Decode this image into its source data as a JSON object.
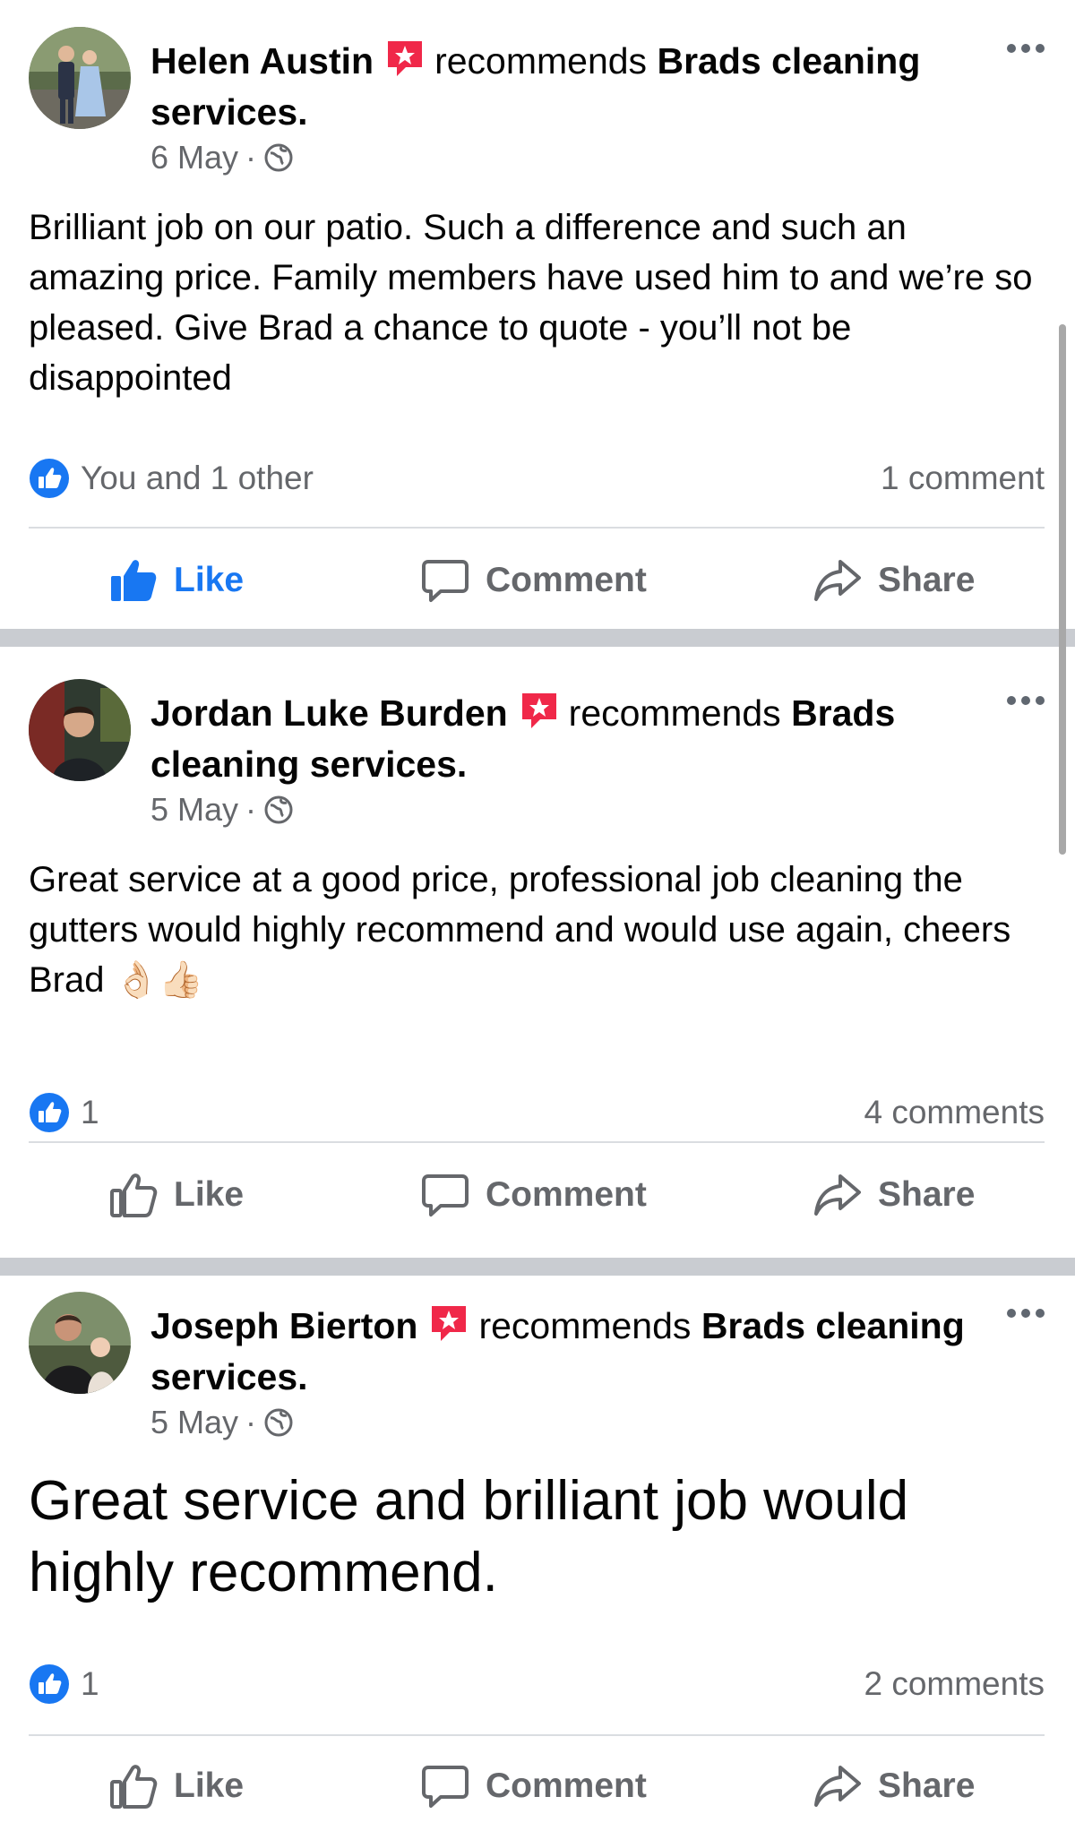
{
  "feed": {
    "recommends_word": "recommends",
    "more_icon": "more-horizontal-icon",
    "badge_icon": "recommendation-badge-icon",
    "audience_icon": "globe-icon",
    "meta_separator": "·",
    "actions": {
      "like": "Like",
      "comment": "Comment",
      "share": "Share"
    },
    "colors": {
      "accent": "#1877f2",
      "badge": "#f02849",
      "secondary_text": "#65676b",
      "separator": "#c9ccd1"
    }
  },
  "posts": [
    {
      "author": "Helen Austin",
      "page": "Brads cleaning services.",
      "date": "6 May",
      "text": "Brilliant job on our patio. Such a difference and such an amazing price. Family members have used him to and we’re so pleased. Give Brad a chance to quote - you’ll not be disappointed",
      "reactions": "You and 1 other",
      "comments": "1 comment",
      "liked_by_viewer": true
    },
    {
      "author": "Jordan Luke Burden",
      "page": "Brads cleaning services.",
      "date": "5 May",
      "text": "Great service at a good price, professional job cleaning the gutters would highly recommend and would use again, cheers Brad",
      "text_emoji": "👌🏻👍🏻",
      "reactions": "1",
      "comments": "4 comments",
      "liked_by_viewer": false
    },
    {
      "author": "Joseph Bierton",
      "page": "Brads cleaning services.",
      "date": "5 May",
      "text": "Great service and brilliant job would highly recommend.",
      "reactions": "1",
      "comments": "2 comments",
      "liked_by_viewer": false
    }
  ]
}
